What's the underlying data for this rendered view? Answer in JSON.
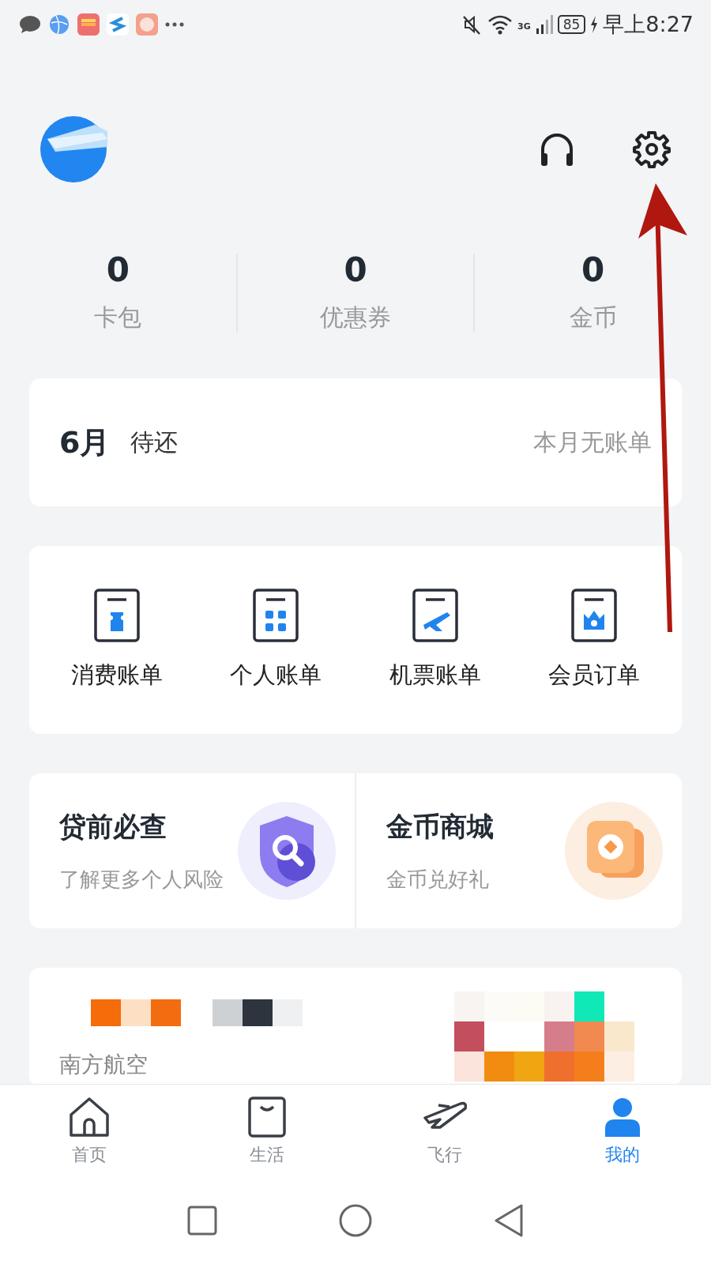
{
  "status_bar": {
    "battery": "85",
    "time": "早上8:27",
    "network": "3G"
  },
  "stats": [
    {
      "value": "0",
      "label": "卡包"
    },
    {
      "value": "0",
      "label": "优惠券"
    },
    {
      "value": "0",
      "label": "金币"
    }
  ],
  "bill_card": {
    "month": "6月",
    "label": "待还",
    "status": "本月无账单"
  },
  "shortcuts": [
    {
      "kind": "ticket",
      "label": "消费账单"
    },
    {
      "kind": "grid",
      "label": "个人账单"
    },
    {
      "kind": "plane",
      "label": "机票账单"
    },
    {
      "kind": "crown",
      "label": "会员订单"
    }
  ],
  "promos": [
    {
      "kind": "shield",
      "title": "贷前必查",
      "subtitle": "了解更多个人风险"
    },
    {
      "kind": "coin",
      "title": "金币商城",
      "subtitle": "金币兑好礼"
    }
  ],
  "banner": {
    "title": "南方航空"
  },
  "tabs": [
    {
      "kind": "home",
      "label": "首页",
      "selected": false
    },
    {
      "kind": "bag",
      "label": "生活",
      "selected": false
    },
    {
      "kind": "plane",
      "label": "飞行",
      "selected": false
    },
    {
      "kind": "person",
      "label": "我的",
      "selected": true
    }
  ]
}
